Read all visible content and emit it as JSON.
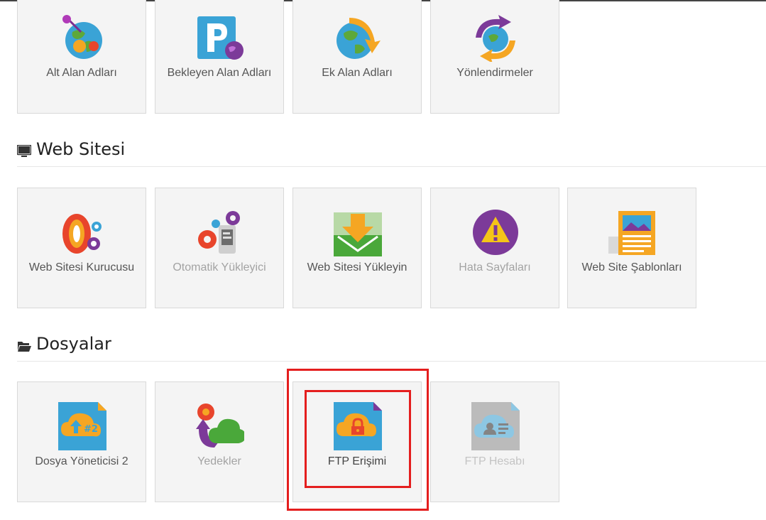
{
  "domains": {
    "items": [
      {
        "label": "Alt Alan Adları",
        "icon": "globe-pin-icon"
      },
      {
        "label": "Bekleyen Alan Adları",
        "icon": "parking-globe-icon"
      },
      {
        "label": "Ek Alan Adları",
        "icon": "globe-arrow-icon"
      },
      {
        "label": "Yönlendirmeler",
        "icon": "redirect-globe-icon"
      }
    ]
  },
  "website": {
    "title": "Web Sitesi",
    "items": [
      {
        "label": "Web Sitesi Kurucusu",
        "icon": "site-builder-icon"
      },
      {
        "label": "Otomatik Yükleyici",
        "icon": "auto-installer-icon"
      },
      {
        "label": "Web Sitesi Yükleyin",
        "icon": "website-upload-icon"
      },
      {
        "label": "Hata Sayfaları",
        "icon": "warning-icon"
      },
      {
        "label": "Web Site Şablonları",
        "icon": "templates-icon"
      }
    ]
  },
  "files": {
    "title": "Dosyalar",
    "items": [
      {
        "label": "Dosya Yöneticisi 2",
        "icon": "cloud-upload-file-icon"
      },
      {
        "label": "Yedekler",
        "icon": "backup-cloud-icon"
      },
      {
        "label": "FTP Erişimi",
        "icon": "ftp-lock-icon"
      },
      {
        "label": "FTP Hesabı",
        "icon": "ftp-account-icon"
      }
    ]
  },
  "colors": {
    "highlight": "#e41e1e",
    "tile_bg": "#f4f4f4"
  }
}
